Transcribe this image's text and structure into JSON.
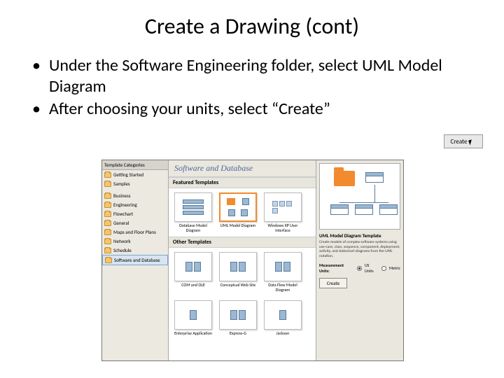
{
  "title": "Create a Drawing (cont)",
  "bullets": [
    "Under the Software Engineering folder, select UML Model Diagram",
    "After choosing your units, select “Create”"
  ],
  "create_badge": "Create",
  "screenshot": {
    "sidebar_header": "Template Categories",
    "categories": [
      "Getting Started",
      "Samples",
      "Business",
      "Engineering",
      "Flowchart",
      "General",
      "Maps and Floor Plans",
      "Network",
      "Schedule",
      "Software and Database"
    ],
    "main_header": "Software and Database",
    "featured_label": "Featured Templates",
    "featured": [
      "Database Model Diagram",
      "UML Model Diagram",
      "Windows XP User Interface"
    ],
    "other_label": "Other Templates",
    "other": [
      "COM and OLE",
      "Conceptual Web Site",
      "Data Flow Model Diagram",
      "Enterprise Application",
      "Express-G",
      "Jackson"
    ],
    "preview": {
      "title": "UML Model Diagram Template",
      "description": "Create models of complex software systems using use-case, class, sequence, component, deployment, activity, and statechart diagrams from the UML notation.",
      "units_label": "Measurement Units:",
      "unit_us": "US Units",
      "unit_metric": "Metric",
      "create": "Create"
    }
  }
}
